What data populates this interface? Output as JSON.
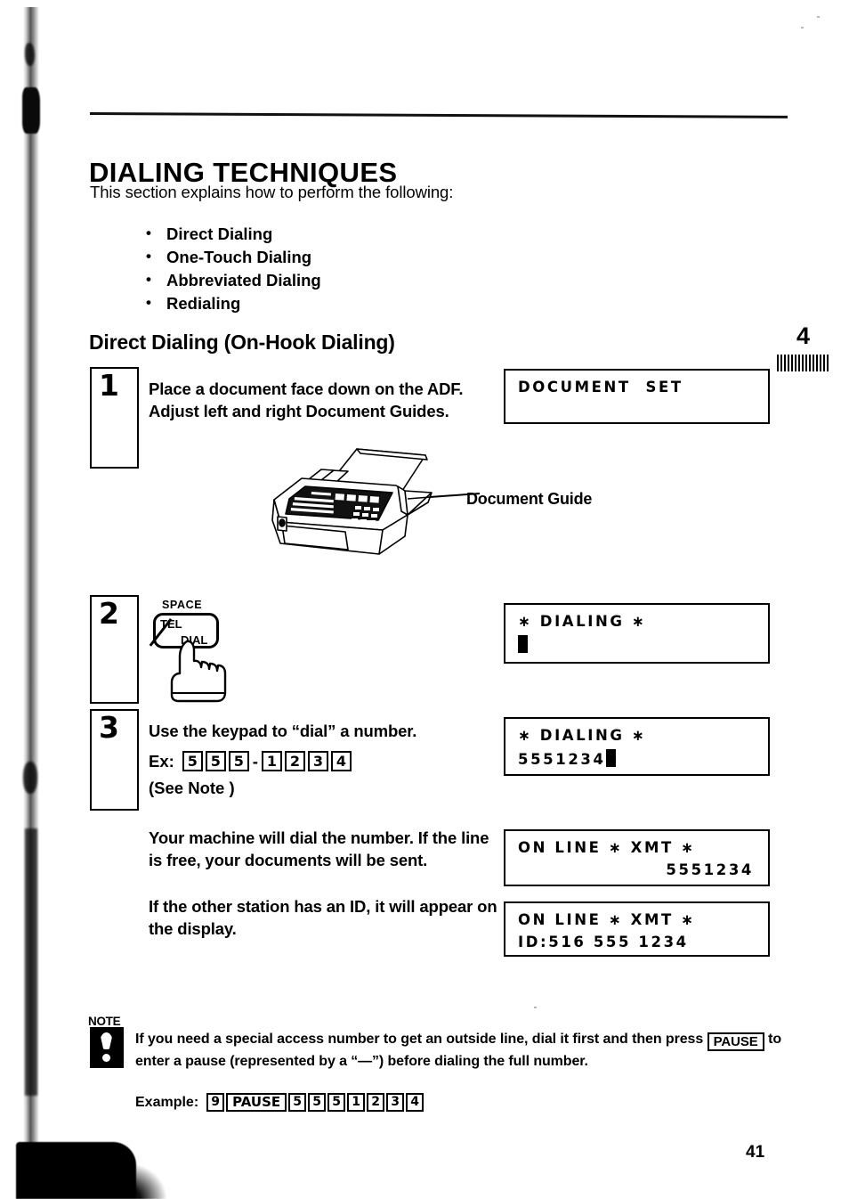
{
  "page": {
    "number": "41",
    "chapter": "4"
  },
  "heading": {
    "title": "DIALING TECHNIQUES",
    "intro": "This section explains how to perform the following:",
    "bullets": [
      "Direct Dialing",
      "One-Touch Dialing",
      "Abbreviated Dialing",
      "Redialing"
    ],
    "subtitle": "Direct Dialing (On-Hook Dialing)"
  },
  "steps": [
    {
      "number": "1",
      "text": "Place a document face down on the ADF. Adjust left and right Document Guides."
    },
    {
      "number": "2",
      "key_label_top": "SPACE",
      "key_label_left": "TEL",
      "key_label_right": "DIAL"
    },
    {
      "number": "3",
      "text": "Use the keypad to “dial” a number.",
      "example_label": "Ex:",
      "example_keys": [
        "5",
        "5",
        "5",
        "-",
        "1",
        "2",
        "3",
        "4"
      ],
      "see_note": "(See Note )"
    }
  ],
  "body": {
    "after_step3_a": "Your machine will dial the number. If the line is free, your documents will be sent.",
    "after_step3_b": "If the other station has an ID, it will appear on the display."
  },
  "illustration": {
    "callout": "Document Guide"
  },
  "displays": [
    {
      "id": "document-set",
      "line1": "DOCUMENT  SET",
      "line2": ""
    },
    {
      "id": "dialing-empty",
      "line1": "∗ DIALING ∗",
      "line2": "",
      "cursor": true
    },
    {
      "id": "dialing-number",
      "line1": "∗ DIALING ∗",
      "line2": "5551234",
      "cursor": true
    },
    {
      "id": "online-xmt-number",
      "line1": "ON LINE ∗ XMT ∗",
      "line2": "5551234",
      "align2": "right"
    },
    {
      "id": "online-xmt-id",
      "line1": "ON LINE ∗ XMT ∗",
      "line2": "ID:516 555 1234"
    }
  ],
  "note": {
    "label": "NOTE",
    "text_part1": "If you need a special access number to get an outside line, dial it first and then press",
    "key": "PAUSE",
    "text_part2": "to enter a pause (represented by a “—”) before dialing the full number.",
    "example_label": "Example:",
    "example_keys": [
      "9",
      "PAUSE",
      "5",
      "5",
      "5",
      "1",
      "2",
      "3",
      "4"
    ]
  }
}
